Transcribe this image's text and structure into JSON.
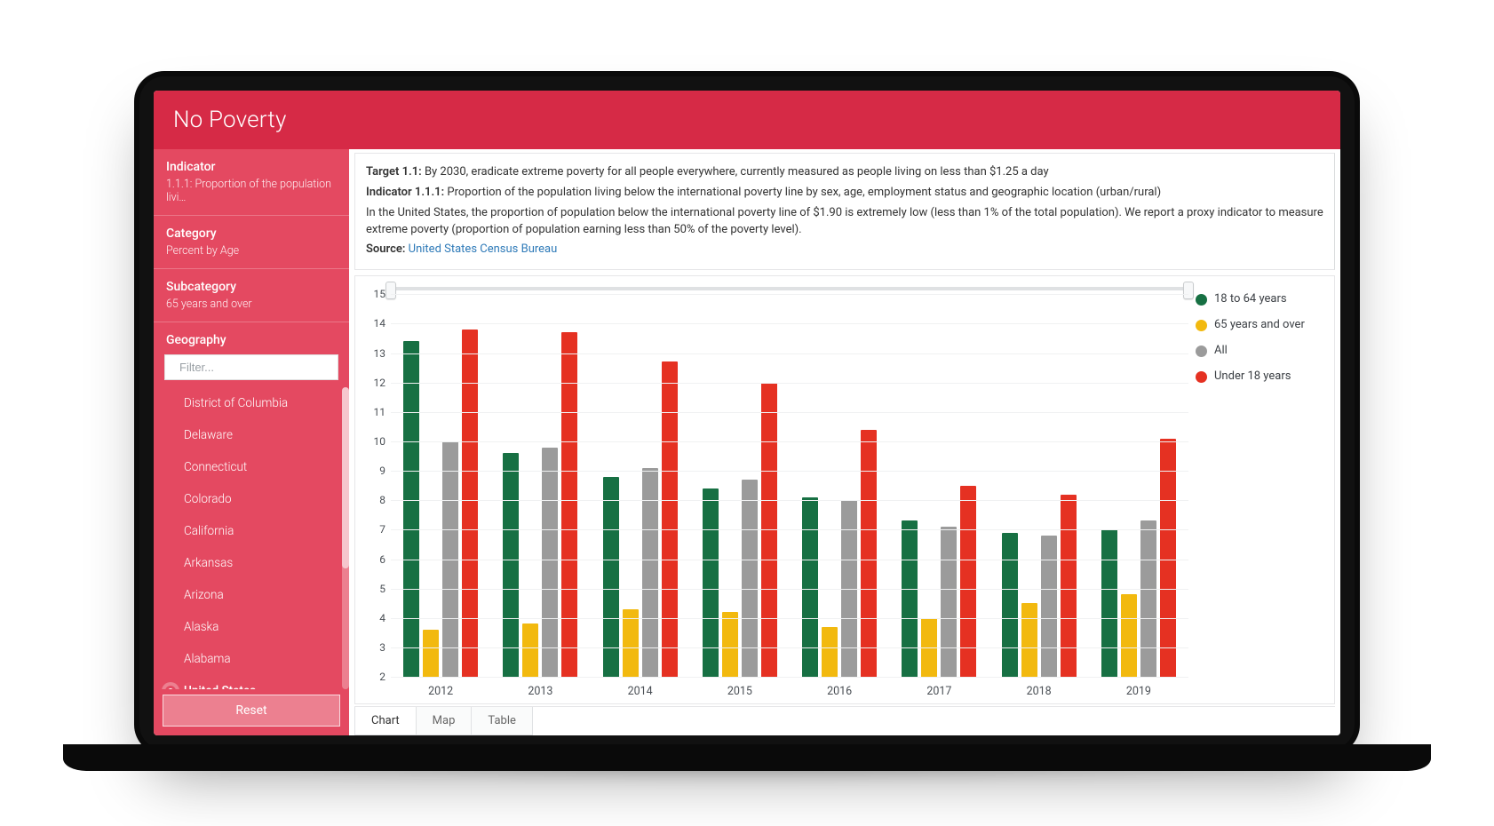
{
  "header_title": "No Poverty",
  "sidebar": {
    "indicator_label": "Indicator",
    "indicator_value": "1.1.1: Proportion of the population livi…",
    "category_label": "Category",
    "category_value": "Percent by Age",
    "subcategory_label": "Subcategory",
    "subcategory_value": "65 years and over",
    "geography_label": "Geography",
    "filter_placeholder": "Filter...",
    "items": [
      {
        "label": "United States",
        "selected": true
      },
      {
        "label": "Alabama",
        "selected": false
      },
      {
        "label": "Alaska",
        "selected": false
      },
      {
        "label": "Arizona",
        "selected": false
      },
      {
        "label": "Arkansas",
        "selected": false
      },
      {
        "label": "California",
        "selected": false
      },
      {
        "label": "Colorado",
        "selected": false
      },
      {
        "label": "Connecticut",
        "selected": false
      },
      {
        "label": "Delaware",
        "selected": false
      },
      {
        "label": "District of Columbia",
        "selected": false
      }
    ],
    "reset_label": "Reset"
  },
  "description": {
    "target_label": "Target 1.1:",
    "target_text": "By 2030, eradicate extreme poverty for all people everywhere, currently measured as people living on less than $1.25 a day",
    "indicator_label": "Indicator 1.1.1:",
    "indicator_text": "Proportion of the population living below the international poverty line by sex, age, employment status and geographic location (urban/rural)",
    "body_text": "In the United States, the proportion of population below the international poverty line of $1.90 is extremely low (less than 1% of the total population). We report a proxy indicator to measure extreme poverty (proportion of population earning less than 50% of the poverty level).",
    "source_label": "Source:",
    "source_link": "United States Census Bureau"
  },
  "chart_data": {
    "type": "bar",
    "categories": [
      "2012",
      "2013",
      "2014",
      "2015",
      "2016",
      "2017",
      "2018",
      "2019"
    ],
    "series": [
      {
        "name": "18 to 64 years",
        "color": "#177043",
        "values": [
          13.4,
          9.6,
          8.8,
          8.4,
          8.1,
          7.3,
          6.9,
          7.0
        ]
      },
      {
        "name": "65 years and over",
        "color": "#f2b90f",
        "values": [
          3.6,
          3.8,
          4.3,
          4.2,
          3.7,
          4.0,
          4.5,
          4.8
        ]
      },
      {
        "name": "All",
        "color": "#9b9b9b",
        "values": [
          10.0,
          9.8,
          9.1,
          8.7,
          8.0,
          7.1,
          6.8,
          7.3
        ]
      },
      {
        "name": "Under 18 years",
        "color": "#e53122",
        "values": [
          13.8,
          13.7,
          12.7,
          12.0,
          10.4,
          8.5,
          8.2,
          10.1
        ]
      }
    ],
    "ylim": [
      2,
      15
    ],
    "yticks": [
      2,
      3,
      4,
      5,
      6,
      7,
      8,
      9,
      10,
      11,
      12,
      13,
      14,
      15
    ]
  },
  "view_tabs": [
    "Chart",
    "Map",
    "Table"
  ],
  "active_tab": "Chart"
}
